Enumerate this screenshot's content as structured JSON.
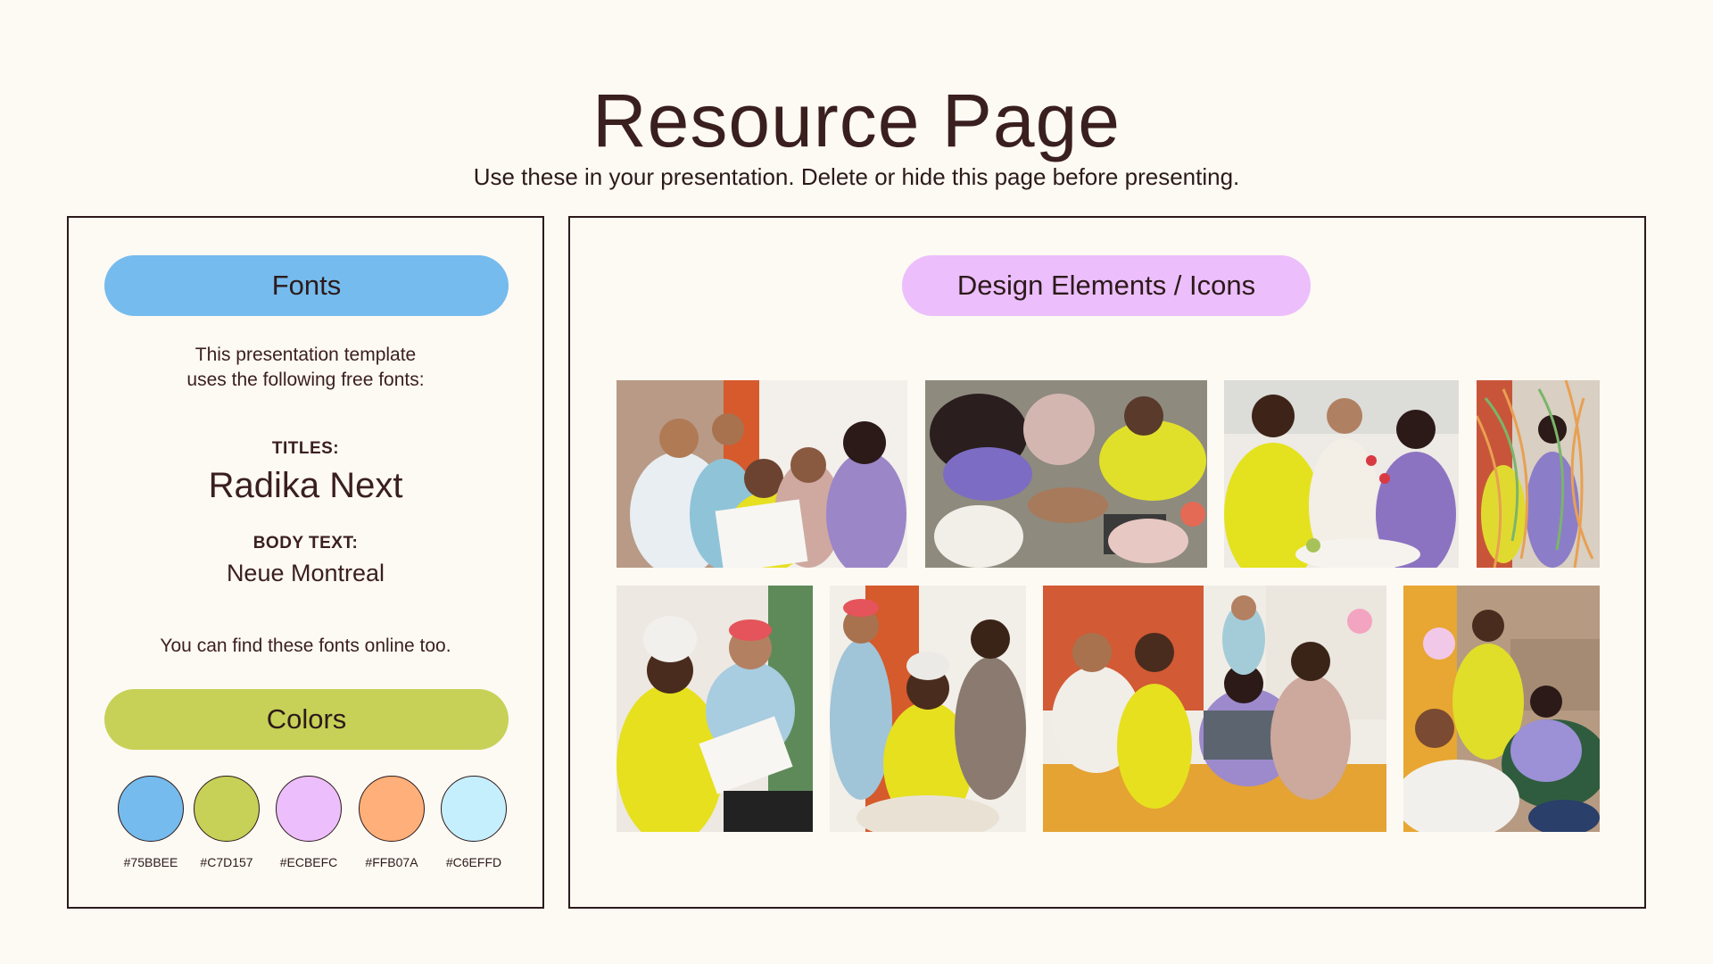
{
  "title": "Resource Page",
  "subtitle": "Use these in your presentation. Delete or hide this page before presenting.",
  "fonts_panel": {
    "header": "Fonts",
    "intro_line1": "This presentation template",
    "intro_line2": "uses the following free fonts:",
    "titles_label": "TITLES:",
    "titles_font": "Radika Next",
    "body_label": "BODY TEXT:",
    "body_font": "Neue Montreal",
    "find_text": "You can find these fonts online too."
  },
  "colors_panel": {
    "header": "Colors",
    "swatches": [
      {
        "hex": "#75BBEE",
        "label": "#75BBEE"
      },
      {
        "hex": "#C7D157",
        "label": "#C7D157"
      },
      {
        "hex": "#ECBEFC",
        "label": "#ECBEFC"
      },
      {
        "hex": "#FFB07A",
        "label": "#FFB07A"
      },
      {
        "hex": "#C6EFFD",
        "label": "#C6EFFD"
      }
    ]
  },
  "design_panel": {
    "header": "Design Elements / Icons",
    "photos": [
      {
        "name": "photo-group-reading-paper"
      },
      {
        "name": "photo-team-hands-together"
      },
      {
        "name": "photo-toasting-drinks"
      },
      {
        "name": "photo-streamers-celebration"
      },
      {
        "name": "photo-pair-reviewing-documents"
      },
      {
        "name": "photo-trio-at-table"
      },
      {
        "name": "photo-group-on-sofa-laptop"
      },
      {
        "name": "photo-conversation-lounge"
      }
    ]
  },
  "colors": {
    "background": "#FDF9F3",
    "text": "#3A1F1F",
    "border": "#2C1A1A"
  }
}
